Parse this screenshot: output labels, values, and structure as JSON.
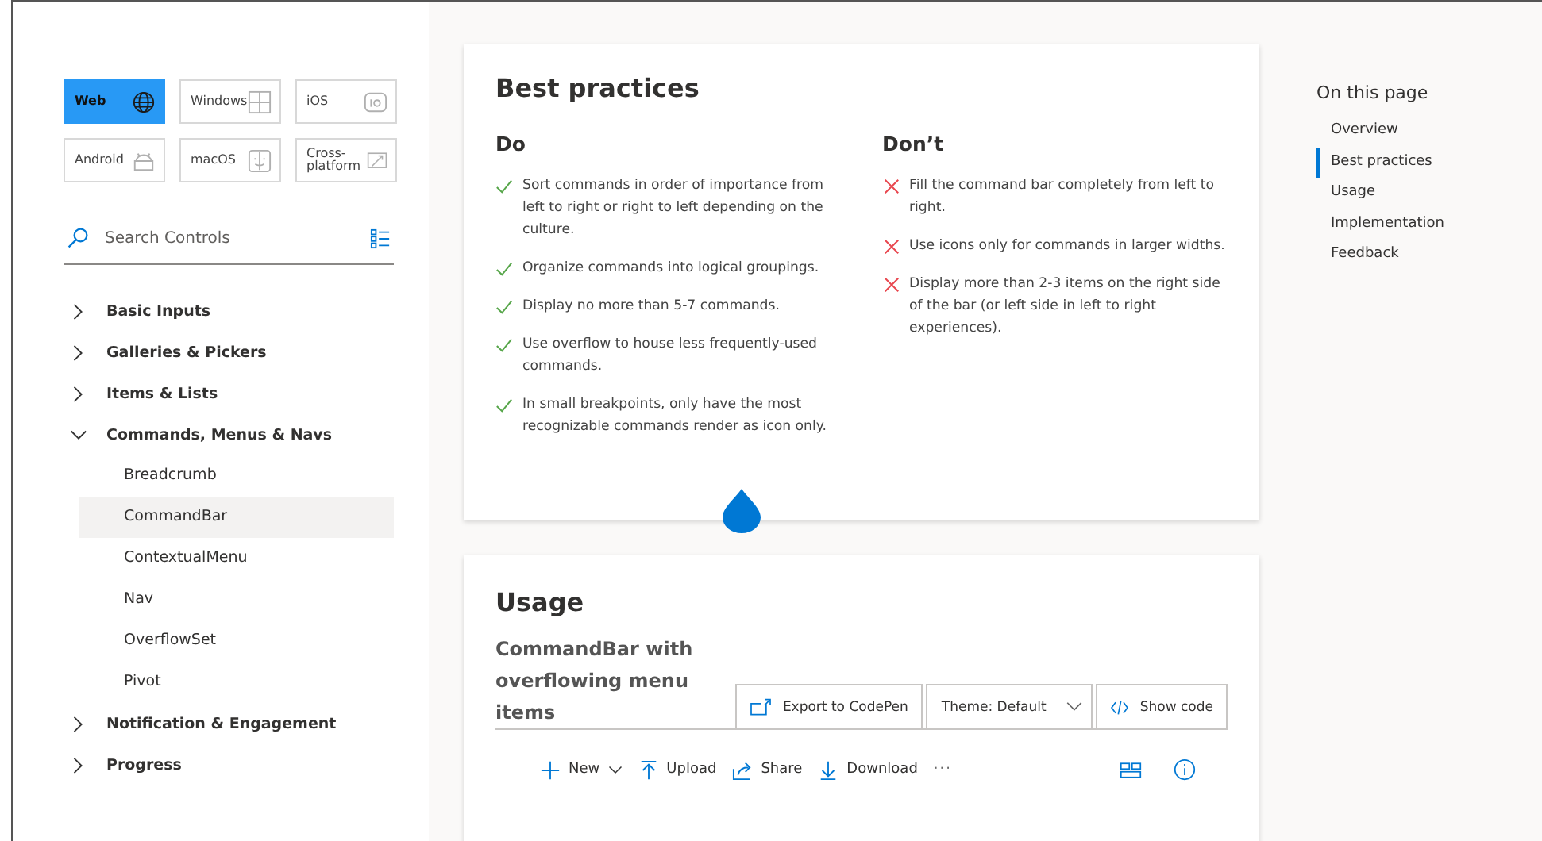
{
  "platforms": [
    {
      "label": "Web",
      "selected": true
    },
    {
      "label": "Windows",
      "selected": false
    },
    {
      "label": "iOS",
      "selected": false
    },
    {
      "label": "Android",
      "selected": false
    },
    {
      "label": "macOS",
      "selected": false
    },
    {
      "label": "Cross-platform",
      "selected": false
    }
  ],
  "search": {
    "placeholder": "Search Controls"
  },
  "nav": [
    {
      "label": "Basic Inputs",
      "expanded": false
    },
    {
      "label": "Galleries & Pickers",
      "expanded": false
    },
    {
      "label": "Items & Lists",
      "expanded": false
    },
    {
      "label": "Commands, Menus & Navs",
      "expanded": true,
      "children": [
        {
          "label": "Breadcrumb",
          "selected": false
        },
        {
          "label": "CommandBar",
          "selected": true
        },
        {
          "label": "ContextualMenu",
          "selected": false
        },
        {
          "label": "Nav",
          "selected": false
        },
        {
          "label": "OverflowSet",
          "selected": false
        },
        {
          "label": "Pivot",
          "selected": false
        }
      ]
    },
    {
      "label": "Notification & Engagement",
      "expanded": false
    },
    {
      "label": "Progress",
      "expanded": false
    }
  ],
  "best_practices": {
    "title": "Best practices",
    "do": {
      "title": "Do",
      "items": [
        "Sort commands in order of importance from left to right or right to left depending on the culture.",
        "Organize commands into logical groupings.",
        "Display no more than 5-7 commands.",
        "Use overflow to house less frequently-used commands.",
        "In small breakpoints, only have the most recognizable commands render as icon only."
      ]
    },
    "dont": {
      "title": "Don’t",
      "items": [
        "Fill the command bar completely from left to right.",
        "Use icons only for commands in larger widths.",
        "Display more than 2-3 items on the right side of the bar (or left side in left to right experiences)."
      ]
    }
  },
  "usage": {
    "title": "Usage",
    "example_title": "CommandBar with overflowing menu items",
    "export_button": "Export to CodePen",
    "theme_dropdown": "Theme: Default",
    "show_code_button": "Show code",
    "commands": [
      {
        "label": "New",
        "dropdown": true
      },
      {
        "label": "Upload",
        "dropdown": false
      },
      {
        "label": "Share",
        "dropdown": false
      },
      {
        "label": "Download",
        "dropdown": false
      }
    ],
    "overflow": "···"
  },
  "toc": {
    "title": "On this page",
    "items": [
      {
        "label": "Overview",
        "selected": false
      },
      {
        "label": "Best practices",
        "selected": true
      },
      {
        "label": "Usage",
        "selected": false
      },
      {
        "label": "Implementation",
        "selected": false
      },
      {
        "label": "Feedback",
        "selected": false
      }
    ]
  }
}
